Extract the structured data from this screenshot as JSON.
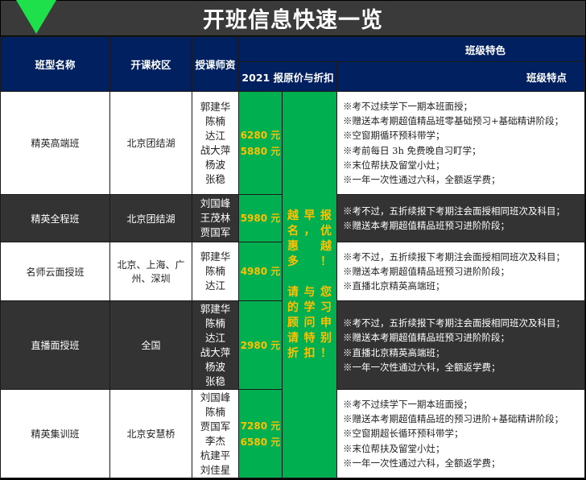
{
  "title": "开班信息快速一览",
  "header": {
    "name": "班型名称",
    "campus": "开课校区",
    "teachers": "授课师资",
    "features_group": "班级特色",
    "price": "2021 报原价与折扣",
    "features": "班级特点"
  },
  "promo": {
    "line1": "越早报名，优惠越多！",
    "line2": "请与您的学习顾问申请特别折扣！"
  },
  "rows": [
    {
      "name": "精英高端班",
      "campus": "北京团结湖",
      "teachers": "郭建华\n陈楠\n达江\n战大萍\n杨波\n张稳",
      "price": "6280 元\n5880 元",
      "features": "※考不过续学下一期本班面授；\n※赠送本考期超值精品班零基础预习+基础精讲阶段；\n※空窗期循环预科带学；\n※考前每日 3h 免费晚自习盯学；\n※末位帮扶及留堂小灶；\n※一年一次性通过六科，全额返学费；"
    },
    {
      "name": "精英全程班",
      "campus": "北京团结湖",
      "teachers": "刘国峰\n王茂林\n贾国军",
      "price": "5980 元",
      "features": "※考不过，五折续报下考期注会面授相同班次及科目；\n※赠送本考期超值精品班预习进阶阶段；"
    },
    {
      "name": "名师云面授班",
      "campus": "北京、上海、广州、深圳",
      "teachers": "郭建华\n陈楠\n达江",
      "price": "4980 元",
      "features": "※考不过，五折续报下考期注会面授相同班次及科目；\n※赠送本考期超值精品班预习进阶阶段；\n※直播北京精英高端班；"
    },
    {
      "name": "直播面授班",
      "campus": "全国",
      "teachers": "郭建华\n陈楠\n达江\n战大萍\n杨波\n张稳",
      "price": "2980 元",
      "features": "※考不过，五折续报下考期注会面授相同班次及科目；\n※赠送本考期超值精品班预习进阶阶段；\n※直播北京精英高端班；\n※一年一次性通过六科，全额返学费；"
    },
    {
      "name": "精英集训班",
      "campus": "北京安慧桥",
      "teachers": "刘国峰\n陈楠\n贾国军\n李杰\n杭建平\n刘佳星",
      "price": "7280 元\n6580 元",
      "features": "※考不过续学下一期本班面授；\n※赠送本考期超值精品班的预习进阶+基础精讲阶段；\n※空窗期超长循环预科带学；\n※末位帮扶及留堂小灶；\n※一年一次性通过六科，全额返学费；"
    }
  ],
  "colors": {
    "header": "#002060",
    "green": "#00b050",
    "price_text": "#ffc000",
    "dark_row": "#333333"
  }
}
